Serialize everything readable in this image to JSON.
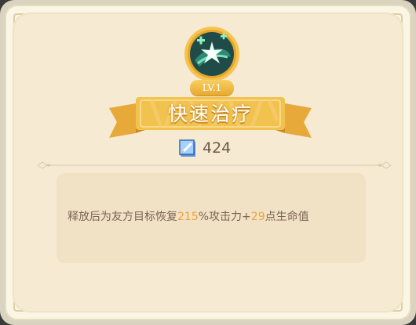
{
  "skill": {
    "level": "LV.1",
    "name": "快速治疗",
    "cost": "424",
    "icon": "heal-burst-icon",
    "cost_icon": "scroll-book-icon"
  },
  "description": {
    "prefix": "释放后为友方目标恢复",
    "percent": "215",
    "mid": "%攻击力+",
    "flat": "29",
    "suffix": "点生命值"
  },
  "colors": {
    "accent": "#f0a13c",
    "ribbon_gold": "#f2c24f",
    "text_brown": "#7a6452",
    "panel_bg": "#f6ead3"
  }
}
